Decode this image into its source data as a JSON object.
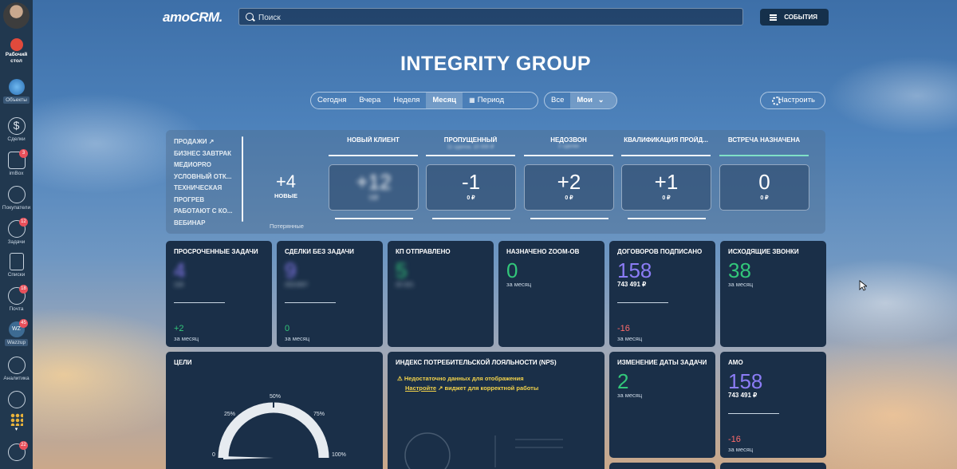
{
  "sidebar": {
    "items": [
      {
        "label": "Рабочий стол",
        "icon": "desktop-icon"
      },
      {
        "label": "Объекты",
        "icon": "objects-icon"
      },
      {
        "label": "Сделки",
        "icon": "deals-icon"
      },
      {
        "label": "imBox",
        "icon": "chat-icon",
        "badge": "3"
      },
      {
        "label": "Покупатели",
        "icon": "customers-icon"
      },
      {
        "label": "Задачи",
        "icon": "tasks-icon",
        "badge": "12"
      },
      {
        "label": "Списки",
        "icon": "lists-icon"
      },
      {
        "label": "Почта",
        "icon": "mail-icon",
        "badge": "18"
      },
      {
        "label": "Wazzup",
        "icon": "wazzup-icon",
        "badge": "45"
      },
      {
        "label": "Аналитика",
        "icon": "analytics-icon"
      },
      {
        "label": "",
        "icon": "settings-icon"
      },
      {
        "label": "",
        "icon": "apps-icon"
      },
      {
        "label": "",
        "icon": "notifications-icon",
        "badge": "22"
      }
    ]
  },
  "header": {
    "logo": "amoCRM.",
    "search_placeholder": "Поиск",
    "events_label": "СОБЫТИЯ"
  },
  "page_title": "INTEGRITY GROUP",
  "period_filter": {
    "options": [
      "Сегодня",
      "Вчера",
      "Неделя",
      "Месяц",
      "Период"
    ],
    "active": "Месяц"
  },
  "owner_filter": {
    "options": [
      "Все",
      "Мои"
    ],
    "active": "Мои"
  },
  "configure_label": "Настроить",
  "funnel": {
    "pipelines": [
      "ПРОДАЖИ",
      "БИЗНЕС ЗАВТРАК",
      "МЕДИОPRO",
      "УСЛОВНЫЙ ОТК...",
      "ТЕХНИЧЕСКАЯ",
      "ПРОГРЕВ",
      "РАБОТАЮТ С КО...",
      "ВЕБИНАР"
    ],
    "new_count": "+4",
    "new_label": "НОВЫЕ",
    "lost_label": "Потерянные",
    "stages": [
      {
        "name": "НОВЫЙ КЛИЕНТ",
        "sub": "",
        "value": "+12",
        "sum": "0 ₽",
        "blurred": true
      },
      {
        "name": "ПРОПУЩЕННЫЙ",
        "sub": "11 сделок, 10 000 ₽",
        "value": "-1",
        "sum": "0 ₽",
        "blurred": false
      },
      {
        "name": "НЕДОЗВОН",
        "sub": "2 сделки",
        "value": "+2",
        "sum": "0 ₽",
        "blurred": false
      },
      {
        "name": "КВАЛИФИКАЦИЯ ПРОЙД...",
        "sub": "",
        "value": "+1",
        "sum": "0 ₽",
        "blurred": false
      },
      {
        "name": "ВСТРЕЧА НАЗНАЧЕНА",
        "sub": "",
        "value": "0",
        "sum": "0 ₽",
        "blurred": false
      }
    ]
  },
  "widgets": {
    "overdue": {
      "title": "ПРОСРОЧЕННЫЕ ЗАДАЧИ",
      "value": "4",
      "sub": "118",
      "delta": "+2",
      "period": "за месяц",
      "color": "#8b7cf5"
    },
    "no_task": {
      "title": "СДЕЛКИ БЕЗ ЗАДАЧИ",
      "value": "9",
      "sub": "2021907",
      "delta": "0",
      "period": "за месяц",
      "color": "#8b7cf5"
    },
    "kp": {
      "title": "КП ОТПРАВЛЕНО",
      "value": "5",
      "sub": "20 321",
      "color": "#32c77a"
    },
    "zoom": {
      "title": "НАЗНАЧЕНО ZOOM-ОВ",
      "value": "0",
      "period": "за месяц",
      "color": "#32c77a"
    },
    "contracts": {
      "title": "ДОГОВОРОВ ПОДПИСАНО",
      "value": "158",
      "sum": "743 491 ₽",
      "delta": "-16",
      "period": "за месяц",
      "color": "#8b7cf5"
    },
    "calls": {
      "title": "ИСХОДЯЩИЕ ЗВОНКИ",
      "value": "38",
      "period": "за месяц",
      "color": "#32c77a"
    },
    "goals": {
      "title": "ЦЕЛИ",
      "ticks": [
        "0",
        "25%",
        "50%",
        "75%",
        "100%"
      ],
      "progress": 0
    },
    "nps": {
      "title": "ИНДЕКС ПОТРЕБИТЕЛЬСКОЙ ЛОЯЛЬНОСТИ (NPS)",
      "warning": "Недостаточно данных для отображения",
      "link": "Настройте",
      "suffix": "виджет для корректной работы"
    },
    "date_change": {
      "title": "ИЗМЕНЕНИЕ ДАТЫ ЗАДАЧИ",
      "value": "2",
      "period": "за месяц",
      "color": "#32c77a"
    },
    "amo": {
      "title": "АМО",
      "value": "158",
      "sum": "743 491 ₽",
      "delta": "-16",
      "period": "за месяц",
      "color": "#8b7cf5"
    }
  },
  "colors": {
    "positive": "#32c77a",
    "negative": "#ff6b6b",
    "purple": "#8b7cf5",
    "card": "#1a2f48"
  }
}
